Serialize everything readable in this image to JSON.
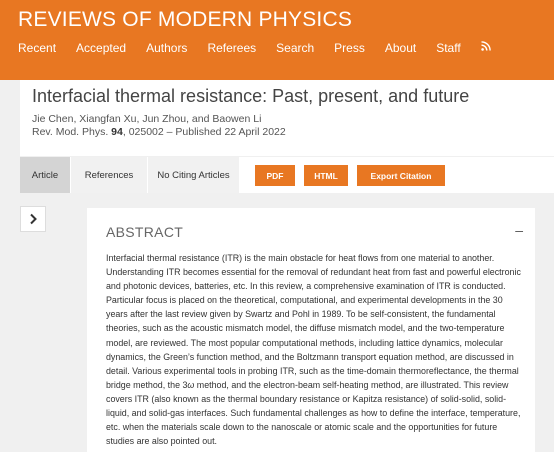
{
  "header": {
    "site_title": "REVIEWS OF MODERN PHYSICS",
    "nav": [
      "Recent",
      "Accepted",
      "Authors",
      "Referees",
      "Search",
      "Press",
      "About",
      "Staff"
    ],
    "rss_icon": "rss-icon"
  },
  "article": {
    "title": "Interfacial thermal resistance: Past, present, and future",
    "authors": "Jie Chen, Xiangfan Xu, Jun Zhou, and Baowen Li",
    "journal": "Rev. Mod. Phys.",
    "volume": "94",
    "pages_published": ", 025002 – Published 22 April 2022"
  },
  "tabs": {
    "article": "Article",
    "references": "References",
    "citing": "No Citing Articles"
  },
  "buttons": {
    "pdf": "PDF",
    "html": "HTML",
    "export": "Export Citation"
  },
  "abstract": {
    "heading": "ABSTRACT",
    "collapse": "–",
    "text_before": "Interfacial thermal resistance (ITR) is the main obstacle for heat flows from one material to another. Understanding ITR becomes essential for the removal of redundant heat from fast and powerful electronic and photonic devices, batteries, etc. In this review, a comprehensive examination of ITR is conducted. Particular focus is placed on the theoretical, computational, and experimental developments in the 30 years after the last review given by Swartz and Pohl in 1989. To be self-consistent, the fundamental theories, such as the acoustic mismatch model, the diffuse mismatch model, and the two-temperature model, are reviewed. The most popular computational methods, including lattice dynamics, molecular dynamics, the Green’s function method, and the Boltzmann transport equation method, are discussed in detail. Various experimental tools in probing ITR, such as the time-domain thermoreflectance, the thermal bridge method, the ",
    "three": "3",
    "omega": "ω",
    "text_after": " method, and the electron-beam self-heating method, are illustrated. This review covers ITR (also known as the thermal boundary resistance or Kapitza resistance) of solid-solid, solid-liquid, and solid-gas interfaces. Such fundamental challenges as how to define the interface, temperature, etc. when the materials scale down to the nanoscale or atomic scale and the opportunities for future studies are also pointed out."
  },
  "colors": {
    "brand": "#e87722",
    "tab_active": "#d4d4d4"
  }
}
